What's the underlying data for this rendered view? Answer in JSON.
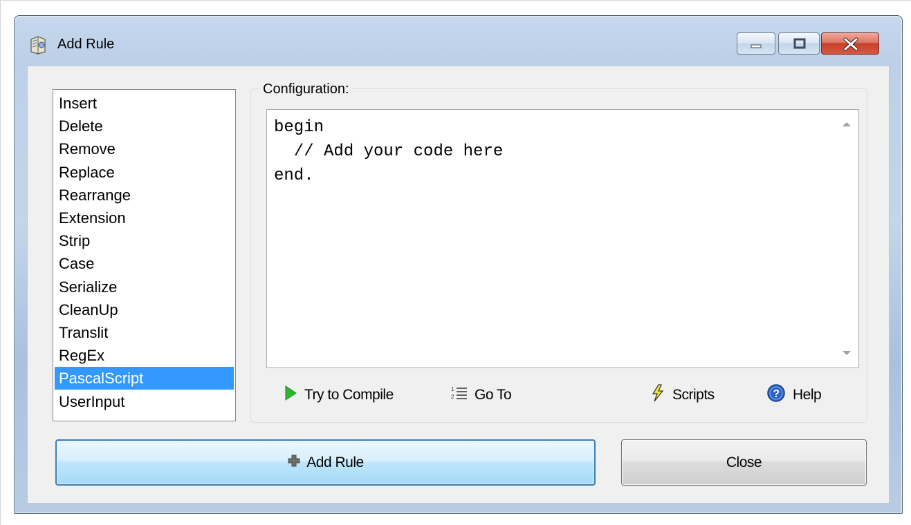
{
  "window": {
    "title": "Add Rule"
  },
  "rules_list": {
    "items": [
      "Insert",
      "Delete",
      "Remove",
      "Replace",
      "Rearrange",
      "Extension",
      "Strip",
      "Case",
      "Serialize",
      "CleanUp",
      "Translit",
      "RegEx",
      "PascalScript",
      "UserInput"
    ],
    "selected": "PascalScript"
  },
  "configuration": {
    "label": "Configuration:",
    "code_lines": [
      "begin",
      "  // Add your code here",
      "end."
    ]
  },
  "toolbar": {
    "try_compile_label": "Try to Compile",
    "goto_label": "Go To",
    "scripts_label": "Scripts",
    "help_label": "Help"
  },
  "buttons": {
    "add_rule_label": "Add Rule",
    "close_label": "Close"
  },
  "colors": {
    "selection": "#3399ff",
    "compile_icon": "#2db52d",
    "help_icon": "#2a63c8",
    "close_button": "#c7412c"
  },
  "icons": {
    "app": "rule-book-icon",
    "compile": "play-icon",
    "goto": "numbered-list-icon",
    "scripts": "lightning-icon",
    "help": "help-circle-icon",
    "add": "plus-icon"
  }
}
